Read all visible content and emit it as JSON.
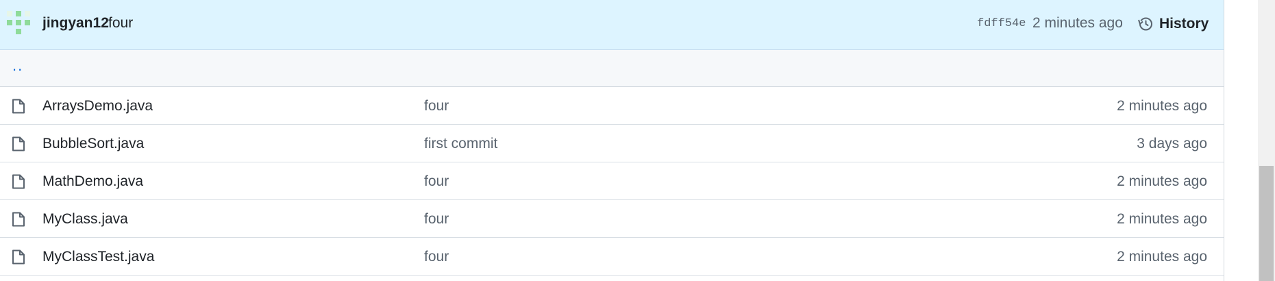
{
  "commit": {
    "author": "jingyan12",
    "message": "four",
    "sha": "fdff54e",
    "time": "2 minutes ago",
    "history_label": "History"
  },
  "parent_link": "..",
  "files": [
    {
      "name": "ArraysDemo.java",
      "message": "four",
      "age": "2 minutes ago"
    },
    {
      "name": "BubbleSort.java",
      "message": "first commit",
      "age": "3 days ago"
    },
    {
      "name": "MathDemo.java",
      "message": "four",
      "age": "2 minutes ago"
    },
    {
      "name": "MyClass.java",
      "message": "four",
      "age": "2 minutes ago"
    },
    {
      "name": "MyClassTest.java",
      "message": "four",
      "age": "2 minutes ago"
    }
  ],
  "icons": {
    "avatar": "identicon-avatar",
    "history": "history-icon",
    "file": "file-icon"
  },
  "colors": {
    "header_bg": "#ddf4ff",
    "parent_row_bg": "#f6f8fa",
    "link": "#0969da",
    "muted_text": "#59636e",
    "avatar_green": "#8fdb9a"
  }
}
